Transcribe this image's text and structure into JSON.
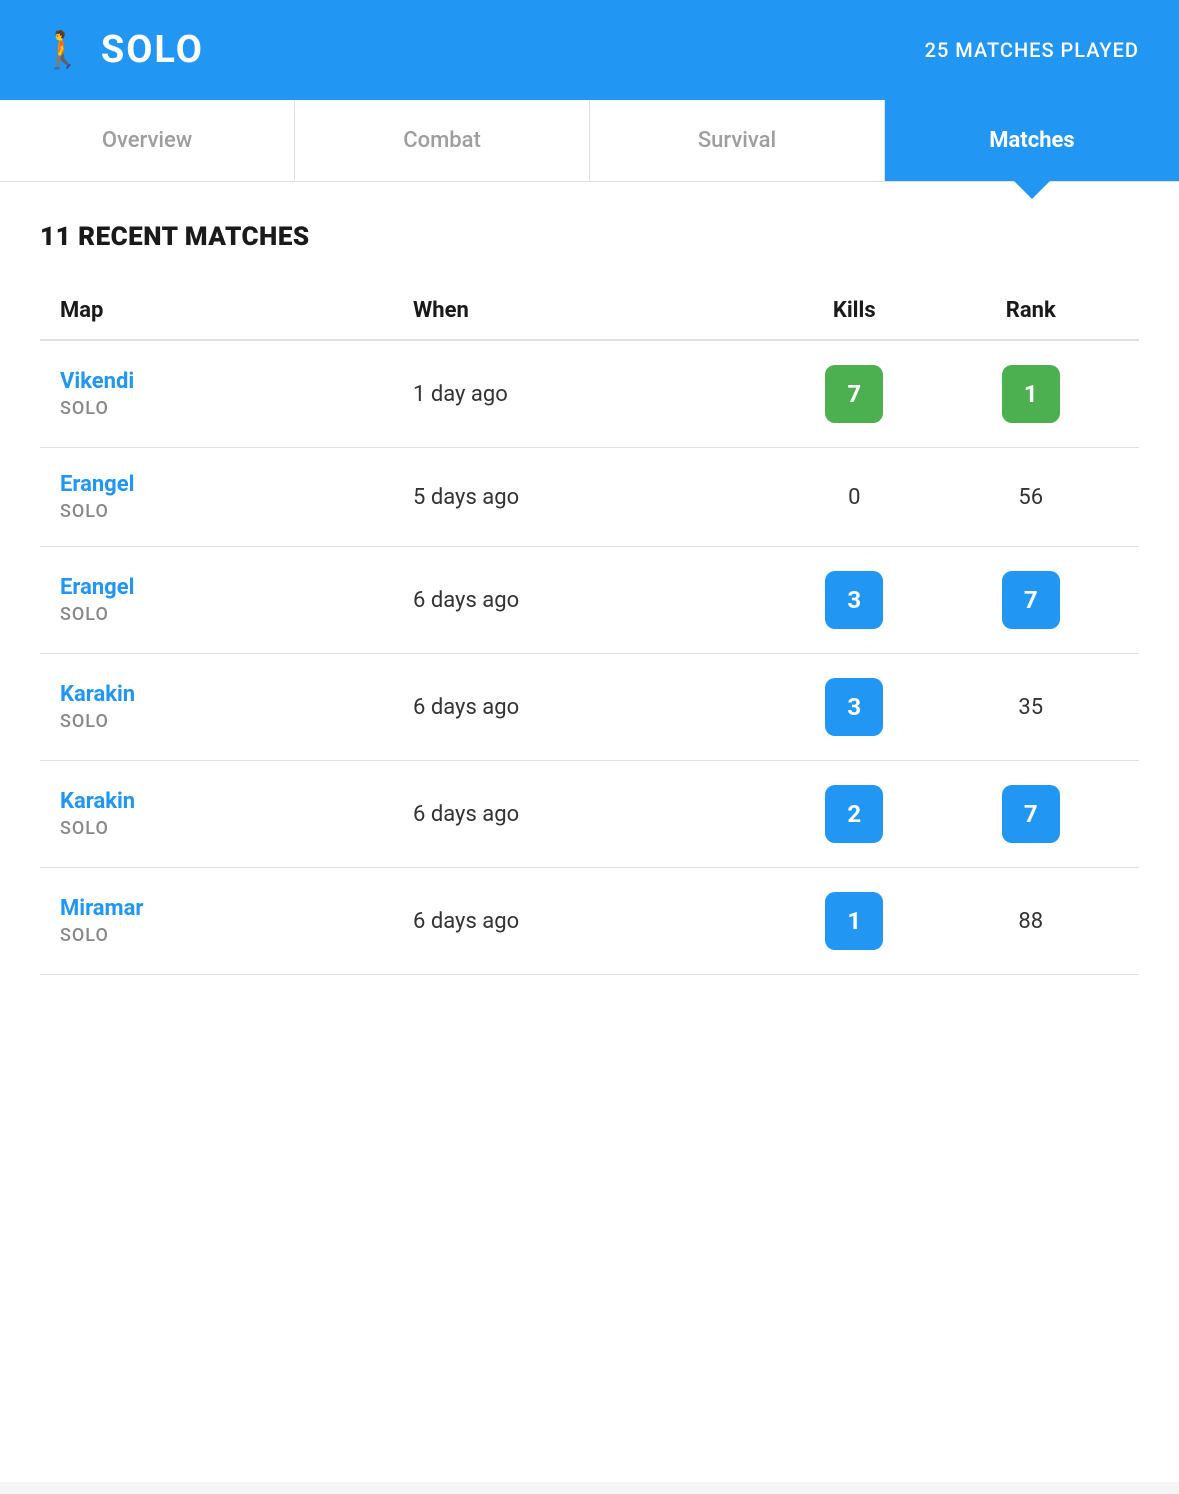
{
  "header": {
    "icon": "🚶",
    "title": "SOLO",
    "matches_played": "25 MATCHES PLAYED"
  },
  "tabs": [
    {
      "id": "overview",
      "label": "Overview",
      "active": false
    },
    {
      "id": "combat",
      "label": "Combat",
      "active": false
    },
    {
      "id": "survival",
      "label": "Survival",
      "active": false
    },
    {
      "id": "matches",
      "label": "Matches",
      "active": true
    }
  ],
  "section_title": "11 RECENT MATCHES",
  "table": {
    "headers": {
      "map": "Map",
      "when": "When",
      "kills": "Kills",
      "rank": "Rank"
    },
    "rows": [
      {
        "map": "Vikendi",
        "mode": "SOLO",
        "when": "1 day ago",
        "kills": "7",
        "kills_badge": "green",
        "rank": "1",
        "rank_badge": "green"
      },
      {
        "map": "Erangel",
        "mode": "SOLO",
        "when": "5 days ago",
        "kills": "0",
        "kills_badge": "none",
        "rank": "56",
        "rank_badge": "none"
      },
      {
        "map": "Erangel",
        "mode": "SOLO",
        "when": "6 days ago",
        "kills": "3",
        "kills_badge": "blue",
        "rank": "7",
        "rank_badge": "blue"
      },
      {
        "map": "Karakin",
        "mode": "SOLO",
        "when": "6 days ago",
        "kills": "3",
        "kills_badge": "blue",
        "rank": "35",
        "rank_badge": "none"
      },
      {
        "map": "Karakin",
        "mode": "SOLO",
        "when": "6 days ago",
        "kills": "2",
        "kills_badge": "blue",
        "rank": "7",
        "rank_badge": "blue"
      },
      {
        "map": "Miramar",
        "mode": "SOLO",
        "when": "6 days ago",
        "kills": "1",
        "kills_badge": "blue",
        "rank": "88",
        "rank_badge": "none"
      }
    ]
  }
}
